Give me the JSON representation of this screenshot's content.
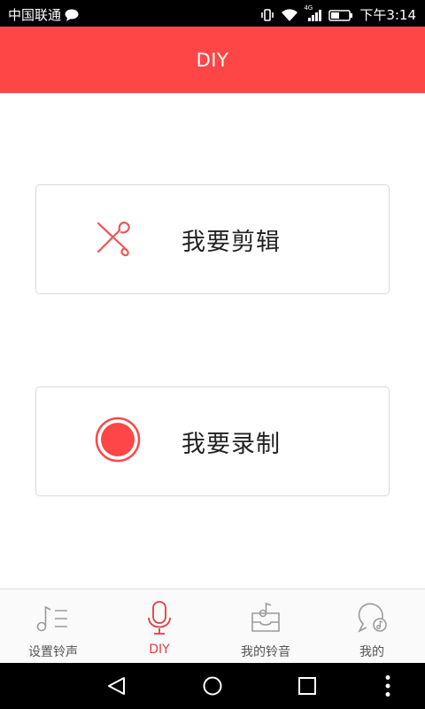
{
  "status_bar": {
    "carrier": "中国联通",
    "time": "下午3:14",
    "network_badge": "4G",
    "icons": [
      "chat-bubble-icon",
      "vibrate-icon",
      "wifi-icon",
      "signal-icon",
      "battery-icon"
    ]
  },
  "header": {
    "title": "DIY"
  },
  "main": {
    "cards": [
      {
        "label": "我要剪辑",
        "icon": "scissors-icon"
      },
      {
        "label": "我要录制",
        "icon": "record-icon"
      }
    ]
  },
  "tab_bar": {
    "active_index": 1,
    "tabs": [
      {
        "label": "设置铃声",
        "icon": "music-list-icon"
      },
      {
        "label": "DIY",
        "icon": "microphone-icon"
      },
      {
        "label": "我的铃音",
        "icon": "music-box-icon"
      },
      {
        "label": "我的",
        "icon": "profile-music-icon"
      }
    ]
  },
  "nav_bar": {
    "buttons": [
      "back-icon",
      "home-icon",
      "recents-icon",
      "more-icon"
    ]
  },
  "colors": {
    "accent": "#fe4646",
    "active_tab": "#e8393f",
    "icon_inactive": "#9a9a9a"
  }
}
